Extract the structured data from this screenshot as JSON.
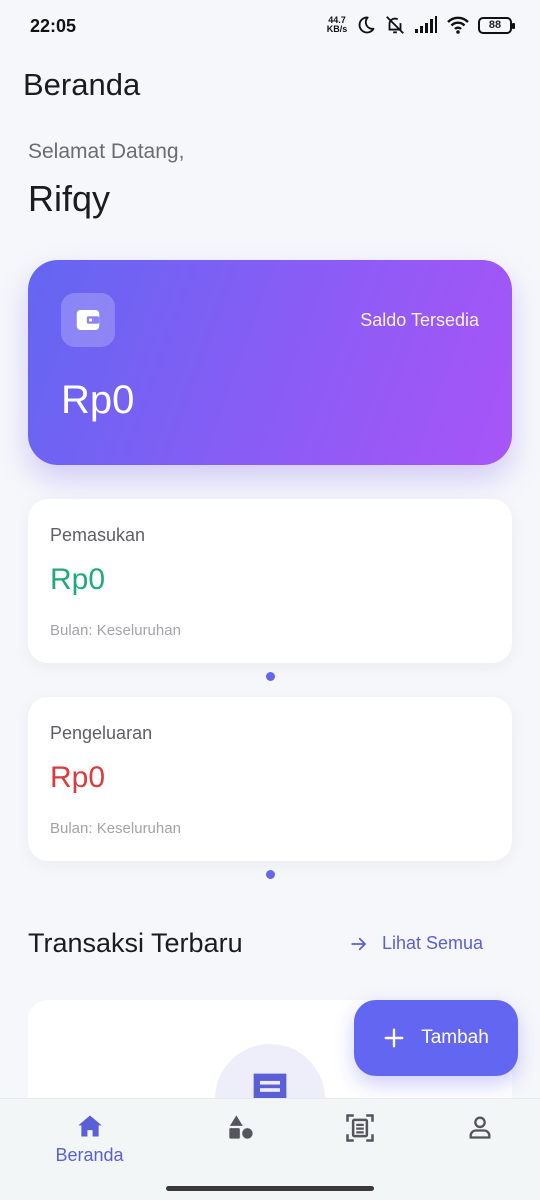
{
  "status_bar": {
    "time": "22:05",
    "net_speed_value": "44.7",
    "net_speed_unit": "KB/s",
    "battery": "88",
    "icons": [
      "moon-icon",
      "mute-icon",
      "signal-icon",
      "wifi-icon",
      "battery-icon"
    ]
  },
  "header": {
    "title": "Beranda"
  },
  "greeting": {
    "text": "Selamat Datang,",
    "name": "Rifqy"
  },
  "balance": {
    "label": "Saldo Tersedia",
    "amount": "Rp0",
    "icon": "wallet-icon",
    "gradient_from": "#6366F1",
    "gradient_to": "#A855F7"
  },
  "income": {
    "label": "Pemasukan",
    "amount": "Rp0",
    "period": "Bulan: Keseluruhan",
    "color": "#22A97A"
  },
  "expense": {
    "label": "Pengeluaran",
    "amount": "Rp0",
    "period": "Bulan: Keseluruhan",
    "color": "#DB3B3B"
  },
  "transactions": {
    "title": "Transaksi Terbaru",
    "see_all": "Lihat Semua",
    "empty_icon": "receipt-icon"
  },
  "fab": {
    "label": "Tambah",
    "icon": "plus-icon"
  },
  "bottom_nav": {
    "items": [
      {
        "label": "Beranda",
        "icon": "home-icon",
        "active": true
      },
      {
        "label": "",
        "icon": "category-icon",
        "active": false
      },
      {
        "label": "",
        "icon": "scan-receipt-icon",
        "active": false
      },
      {
        "label": "",
        "icon": "profile-icon",
        "active": false
      }
    ]
  },
  "colors": {
    "accent": "#6366F1",
    "background": "#F6F7FB",
    "nav_background": "#F2F6F6"
  }
}
